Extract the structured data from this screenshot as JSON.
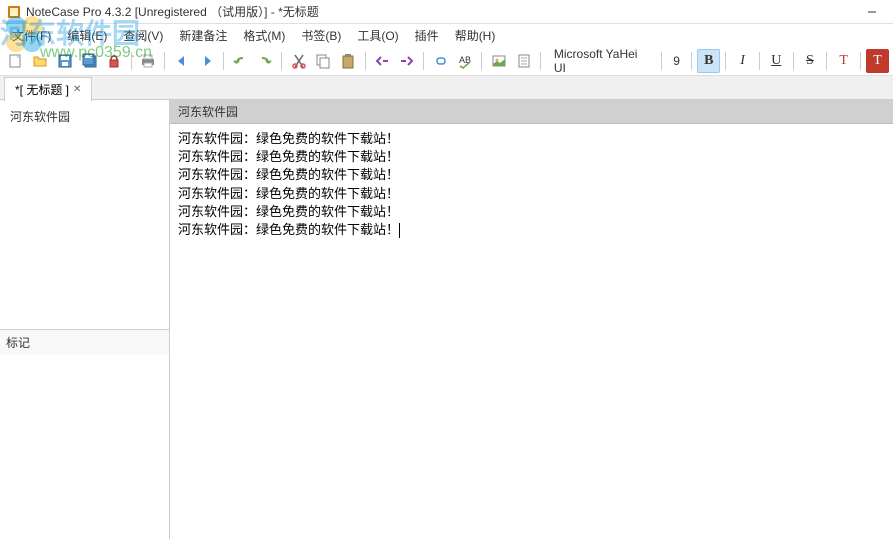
{
  "titlebar": {
    "title": "NoteCase Pro 4.3.2 [Unregistered （试用版）] - *无标题"
  },
  "menubar": {
    "items": [
      {
        "label": "文件(F)"
      },
      {
        "label": "编辑(E)"
      },
      {
        "label": "查阅(V)"
      },
      {
        "label": "新建备注"
      },
      {
        "label": "格式(M)"
      },
      {
        "label": "书签(B)"
      },
      {
        "label": "工具(O)"
      },
      {
        "label": "插件"
      },
      {
        "label": "帮助(H)"
      }
    ]
  },
  "toolbar": {
    "font_name": "Microsoft YaHei UI",
    "font_size": "9"
  },
  "tabbar": {
    "tab_label": "*[ 无标题 ]",
    "close_glyph": "✕"
  },
  "sidebar": {
    "tree_item": "河东软件园",
    "tags_label": "标记"
  },
  "note": {
    "title": "河东软件园",
    "lines": [
      "河东软件园：绿色免费的软件下载站！",
      "河东软件园：绿色免费的软件下载站！",
      "河东软件园：绿色免费的软件下载站！",
      "河东软件园：绿色免费的软件下载站！",
      "河东软件园：绿色免费的软件下载站！",
      "河东软件园：绿色免费的软件下载站！"
    ]
  },
  "watermark": {
    "main": "河东软件园",
    "url": "www.pc0359.cn"
  },
  "fmt": {
    "bold": "B",
    "italic": "I",
    "underline": "U",
    "strike": "S",
    "textcolor": "T",
    "highlight": "T"
  }
}
